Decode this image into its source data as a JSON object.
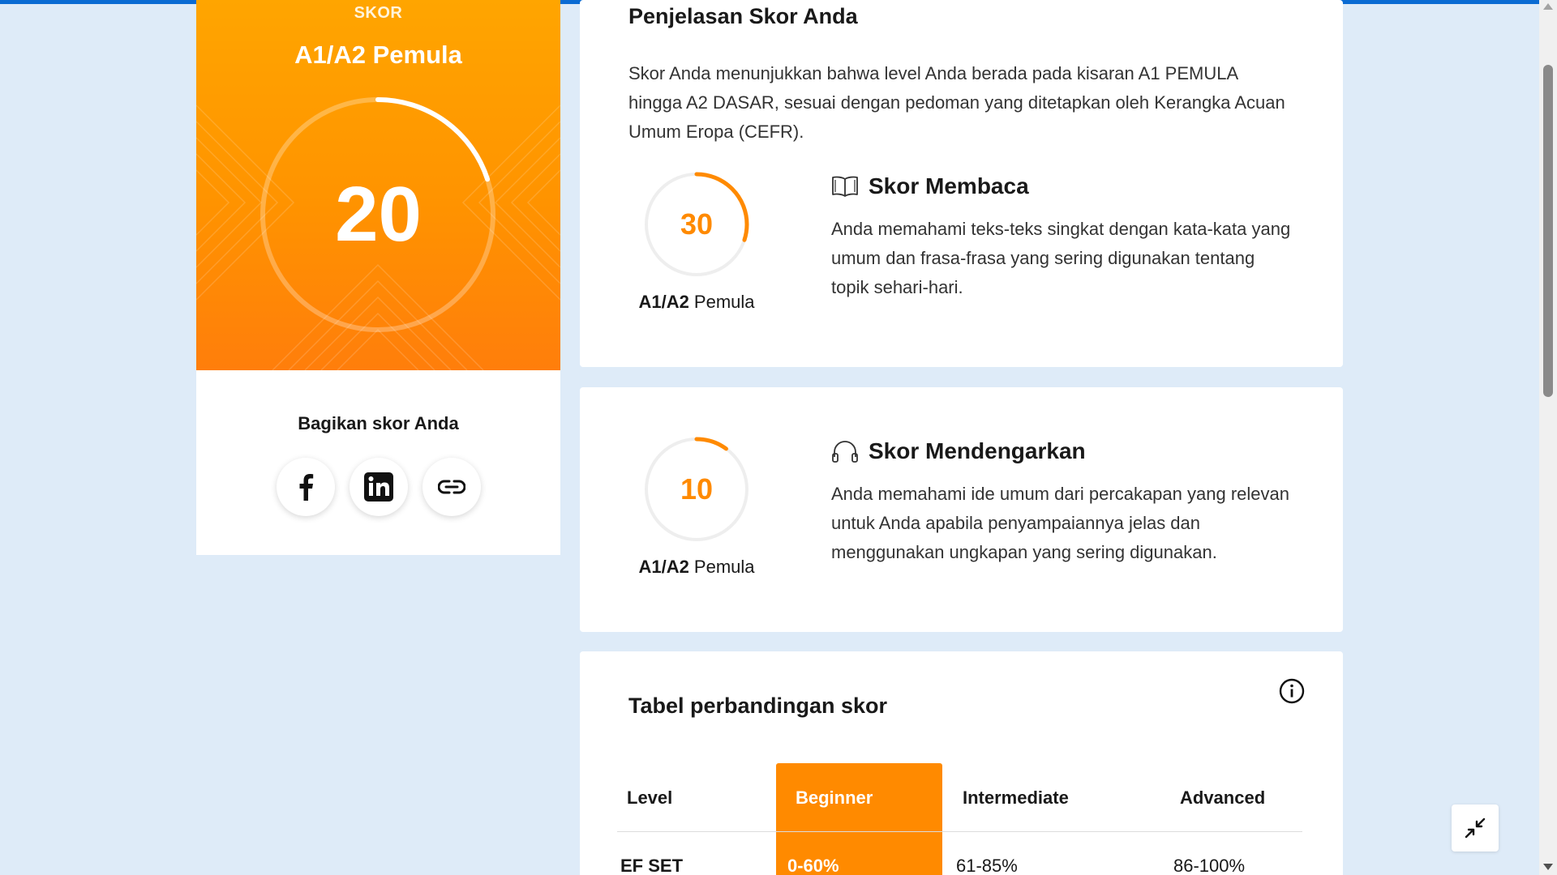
{
  "score_card": {
    "label": "SKOR",
    "level": "A1/A2 Pemula",
    "score": "20",
    "score_progress": 0.2,
    "share_title": "Bagikan skor Anda",
    "share_buttons": [
      {
        "name": "facebook",
        "icon": "facebook-icon"
      },
      {
        "name": "linkedin",
        "icon": "linkedin-icon"
      },
      {
        "name": "copy-link",
        "icon": "link-icon"
      }
    ]
  },
  "explanation": {
    "title": "Penjelasan Skor Anda",
    "paragraph": "Skor Anda menunjukkan bahwa level Anda berada pada kisaran A1 PEMULA hingga A2 DASAR, sesuai dengan pedoman yang ditetapkan oleh Kerangka Acuan Umum Eropa (CEFR).",
    "reading": {
      "icon": "book-icon",
      "title": "Skor Membaca",
      "score": "30",
      "progress": 0.3,
      "level_bold": "A1/A2",
      "level_text": " Pemula",
      "text": "Anda memahami teks-teks singkat dengan kata-kata yang umum dan frasa-frasa yang sering digunakan tentang topik sehari-hari."
    }
  },
  "listening": {
    "icon": "headphones-icon",
    "title": "Skor Mendengarkan",
    "score": "10",
    "progress": 0.1,
    "level_bold": "A1/A2",
    "level_text": " Pemula",
    "text": "Anda memahami ide umum dari percakapan yang relevan untuk Anda apabila penyampaiannya jelas dan menggunakan ungkapan yang sering digunakan."
  },
  "comparison": {
    "title": "Tabel perbandingan skor",
    "headers": [
      "Level",
      "Beginner",
      "Intermediate",
      "Advanced"
    ],
    "rows": [
      [
        "EF SET",
        "0-60%",
        "61-85%",
        "86-100%"
      ]
    ]
  },
  "colors": {
    "accent": "#ff8a00",
    "top_bar": "#0a6bd3",
    "page_bg": "#deebf8"
  }
}
